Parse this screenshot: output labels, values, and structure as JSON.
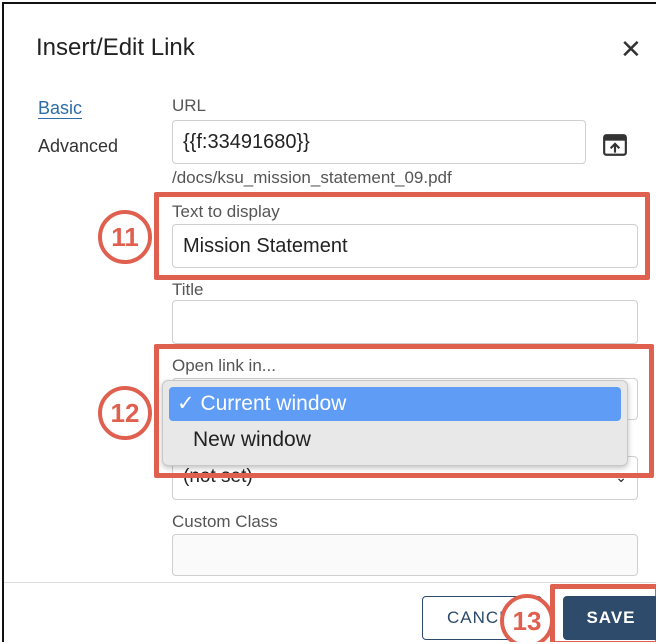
{
  "dialog": {
    "title": "Insert/Edit Link",
    "close_glyph": "✕"
  },
  "tabs": [
    {
      "label": "Basic",
      "active": true
    },
    {
      "label": "Advanced",
      "active": false
    }
  ],
  "fields": {
    "url_label": "URL",
    "url_value": "{{f:33491680}}",
    "url_helper": "/docs/ksu_mission_statement_09.pdf",
    "text_label": "Text to display",
    "text_value": "Mission Statement",
    "title_label": "Title",
    "title_value": "",
    "open_label": "Open link in...",
    "open_options": [
      "Current window",
      "New window"
    ],
    "rel_value": "(not set)",
    "class_label": "Custom Class",
    "class_value": ""
  },
  "dropdown": {
    "selected_check": "✓",
    "option_1": "Current window",
    "option_2": "New window"
  },
  "callouts": [
    "11",
    "12",
    "13"
  ],
  "footer": {
    "cancel_label": "CANCEL",
    "save_label": "SAVE"
  },
  "colors": {
    "accent": "#2d6da8",
    "save_bg": "#2f4b6b",
    "highlight": "#e06050",
    "selected_option": "#5f9cf5"
  },
  "icons": {
    "upload": "upload-icon",
    "close": "close-icon",
    "chevron": "chevron-down-icon"
  }
}
